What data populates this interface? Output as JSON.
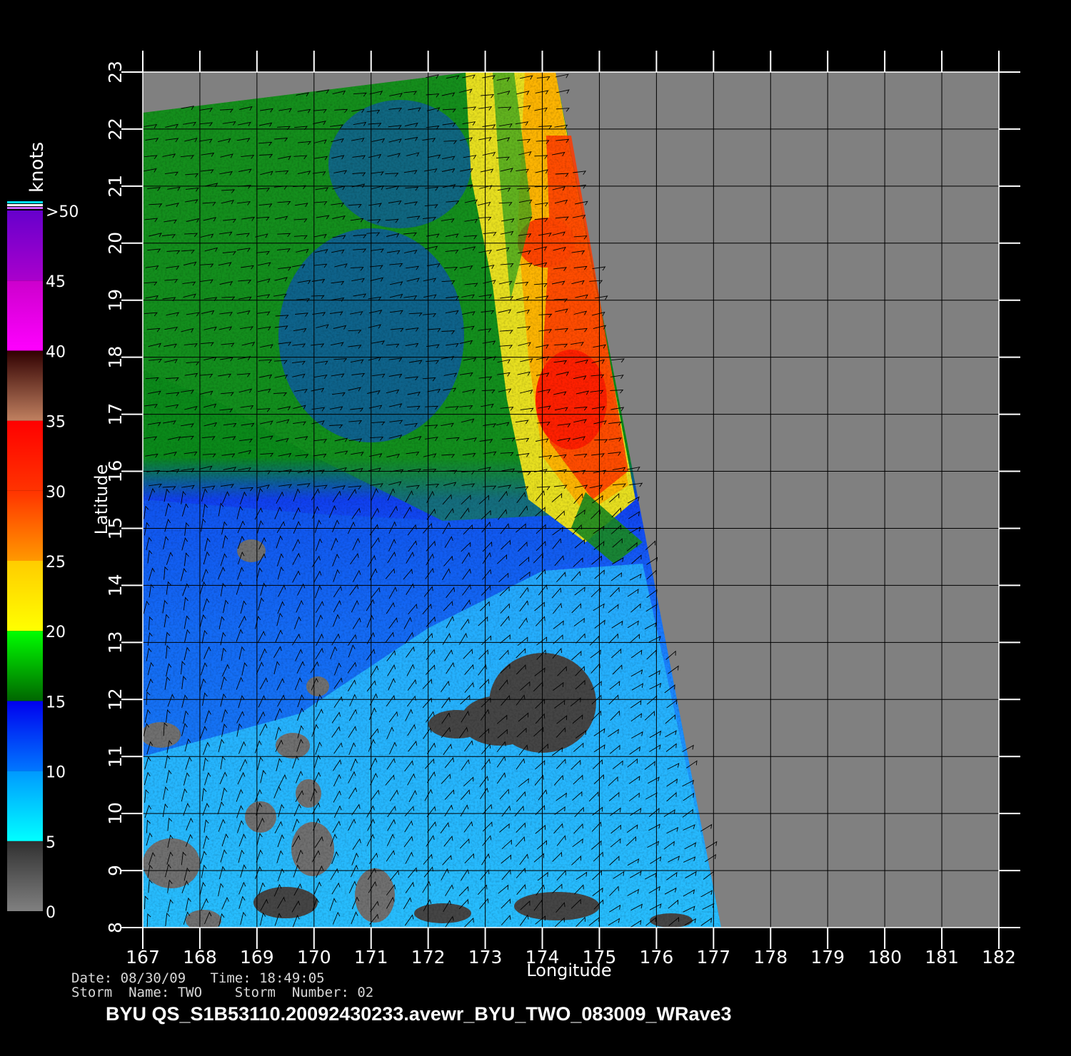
{
  "map": {
    "xlabel": "Longitude",
    "ylabel": "Latitude",
    "lon_range": [
      167,
      182
    ],
    "lat_range": [
      8,
      23
    ],
    "lon_ticks": [
      "167",
      "168",
      "169",
      "170",
      "171",
      "172",
      "173",
      "174",
      "175",
      "176",
      "177",
      "178",
      "179",
      "180",
      "181",
      "182"
    ],
    "lat_ticks": [
      "8",
      "9",
      "10",
      "11",
      "12",
      "13",
      "14",
      "15",
      "16",
      "17",
      "18",
      "19",
      "20",
      "21",
      "22",
      "23"
    ],
    "grid": true,
    "no_data_color": "#808080"
  },
  "legend": {
    "units": "knots",
    "bins": [
      {
        "from": 0,
        "to": 5,
        "colors": [
          "#808080",
          "#303030"
        ]
      },
      {
        "from": 5,
        "to": 10,
        "colors": [
          "#00ffff",
          "#0099ff"
        ]
      },
      {
        "from": 10,
        "to": 15,
        "colors": [
          "#0077ff",
          "#0000ee"
        ]
      },
      {
        "from": 15,
        "to": 20,
        "colors": [
          "#006600",
          "#00ff00"
        ]
      },
      {
        "from": 20,
        "to": 25,
        "colors": [
          "#ffff00",
          "#ffcc00"
        ]
      },
      {
        "from": 25,
        "to": 30,
        "colors": [
          "#ff9900",
          "#ff3300"
        ]
      },
      {
        "from": 30,
        "to": 35,
        "colors": [
          "#ff3300",
          "#ff0000"
        ]
      },
      {
        "from": 35,
        "to": 40,
        "colors": [
          "#c08060",
          "#300000"
        ]
      },
      {
        "from": 40,
        "to": 45,
        "colors": [
          "#ff00ff",
          "#cc00cc"
        ]
      },
      {
        "from": 45,
        "to": 50,
        "colors": [
          "#aa00cc",
          "#6600cc"
        ]
      }
    ],
    "tick_labels": [
      "0",
      "5",
      "10",
      "15",
      "20",
      "25",
      "30",
      "35",
      "40",
      "45",
      ">50"
    ]
  },
  "info": {
    "date_line": "Date: 08/30/09   Time: 18:49:05",
    "storm_line": "Storm  Name: TWO    Storm  Number: 02",
    "title": "BYU  QS_S1B53110.20092430233.avewr_BYU_TWO_083009_WRave3"
  }
}
